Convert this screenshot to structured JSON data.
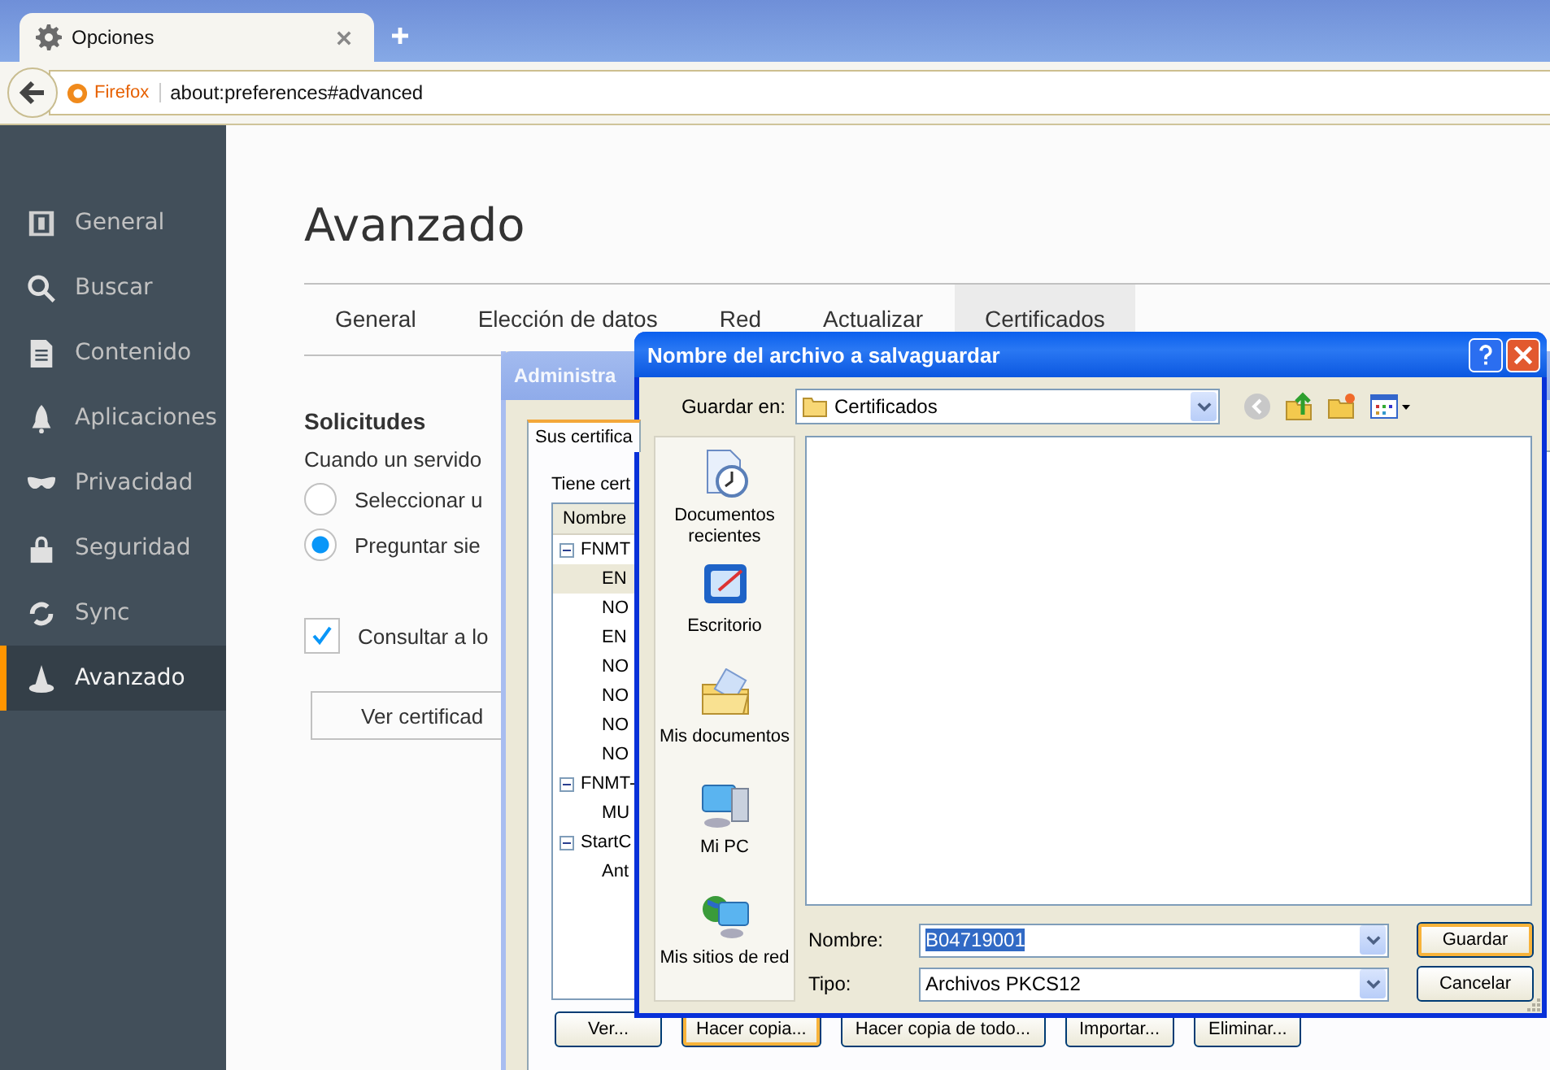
{
  "browser": {
    "tab": {
      "title": "Opciones",
      "selected": true
    },
    "identity": "Firefox",
    "url": "about:preferences#advanced"
  },
  "sidebar": {
    "items": [
      {
        "label": "General",
        "selected": false
      },
      {
        "label": "Buscar",
        "selected": false
      },
      {
        "label": "Contenido",
        "selected": false
      },
      {
        "label": "Aplicaciones",
        "selected": false
      },
      {
        "label": "Privacidad",
        "selected": false
      },
      {
        "label": "Seguridad",
        "selected": false
      },
      {
        "label": "Sync",
        "selected": false
      },
      {
        "label": "Avanzado",
        "selected": true
      }
    ]
  },
  "page": {
    "heading": "Avanzado",
    "tabs": [
      {
        "label": "General",
        "selected": false
      },
      {
        "label": "Elección de datos",
        "selected": false
      },
      {
        "label": "Red",
        "selected": false
      },
      {
        "label": "Actualizar",
        "selected": false
      },
      {
        "label": "Certificados",
        "selected": true
      }
    ],
    "section_title": "Solicitudes",
    "prompt": "Cuando un servido",
    "options": [
      {
        "label": "Seleccionar u",
        "selected": false
      },
      {
        "label": "Preguntar sie",
        "selected": true
      }
    ],
    "ocsp": {
      "label": "Consultar a lo",
      "checked": true
    },
    "button": "Ver certificad"
  },
  "cert_manager": {
    "title": "Administra",
    "tab": {
      "label": "Sus certifica",
      "selected": true
    },
    "intro": "Tiene cert",
    "column": "Nombre",
    "tree": [
      {
        "label": "FNMT",
        "expanded": true,
        "children": [
          {
            "label": "EN",
            "selected": true
          },
          {
            "label": "NO",
            "selected": false
          },
          {
            "label": "EN",
            "selected": false
          },
          {
            "label": "NO",
            "selected": false
          },
          {
            "label": "NO",
            "selected": false
          },
          {
            "label": "NO",
            "selected": false
          },
          {
            "label": "NO",
            "selected": false
          }
        ]
      },
      {
        "label": "FNMT-",
        "expanded": true,
        "children": [
          {
            "label": "MU",
            "selected": false
          }
        ]
      },
      {
        "label": "StartC",
        "expanded": true,
        "children": [
          {
            "label": "Ant",
            "selected": false
          }
        ]
      }
    ],
    "buttons": [
      {
        "label": "Ver...",
        "focused": false
      },
      {
        "label": "Hacer copia...",
        "focused": true
      },
      {
        "label": "Hacer copia de todo...",
        "focused": false
      },
      {
        "label": "Importar...",
        "focused": false
      },
      {
        "label": "Eliminar...",
        "focused": false
      }
    ]
  },
  "save_dialog": {
    "title": "Nombre del archivo a salvaguardar",
    "save_in": {
      "label": "Guardar en:",
      "value": "Certificados"
    },
    "places": [
      {
        "label": "Documentos recientes"
      },
      {
        "label": "Escritorio"
      },
      {
        "label": "Mis documentos"
      },
      {
        "label": "Mi PC"
      },
      {
        "label": "Mis sitios de red"
      }
    ],
    "filename": {
      "label": "Nombre:",
      "value": "B04719001"
    },
    "type": {
      "label": "Tipo:",
      "value": "Archivos PKCS12"
    },
    "buttons": [
      {
        "label": "Guardar",
        "default": true
      },
      {
        "label": "Cancelar",
        "default": false
      }
    ]
  }
}
